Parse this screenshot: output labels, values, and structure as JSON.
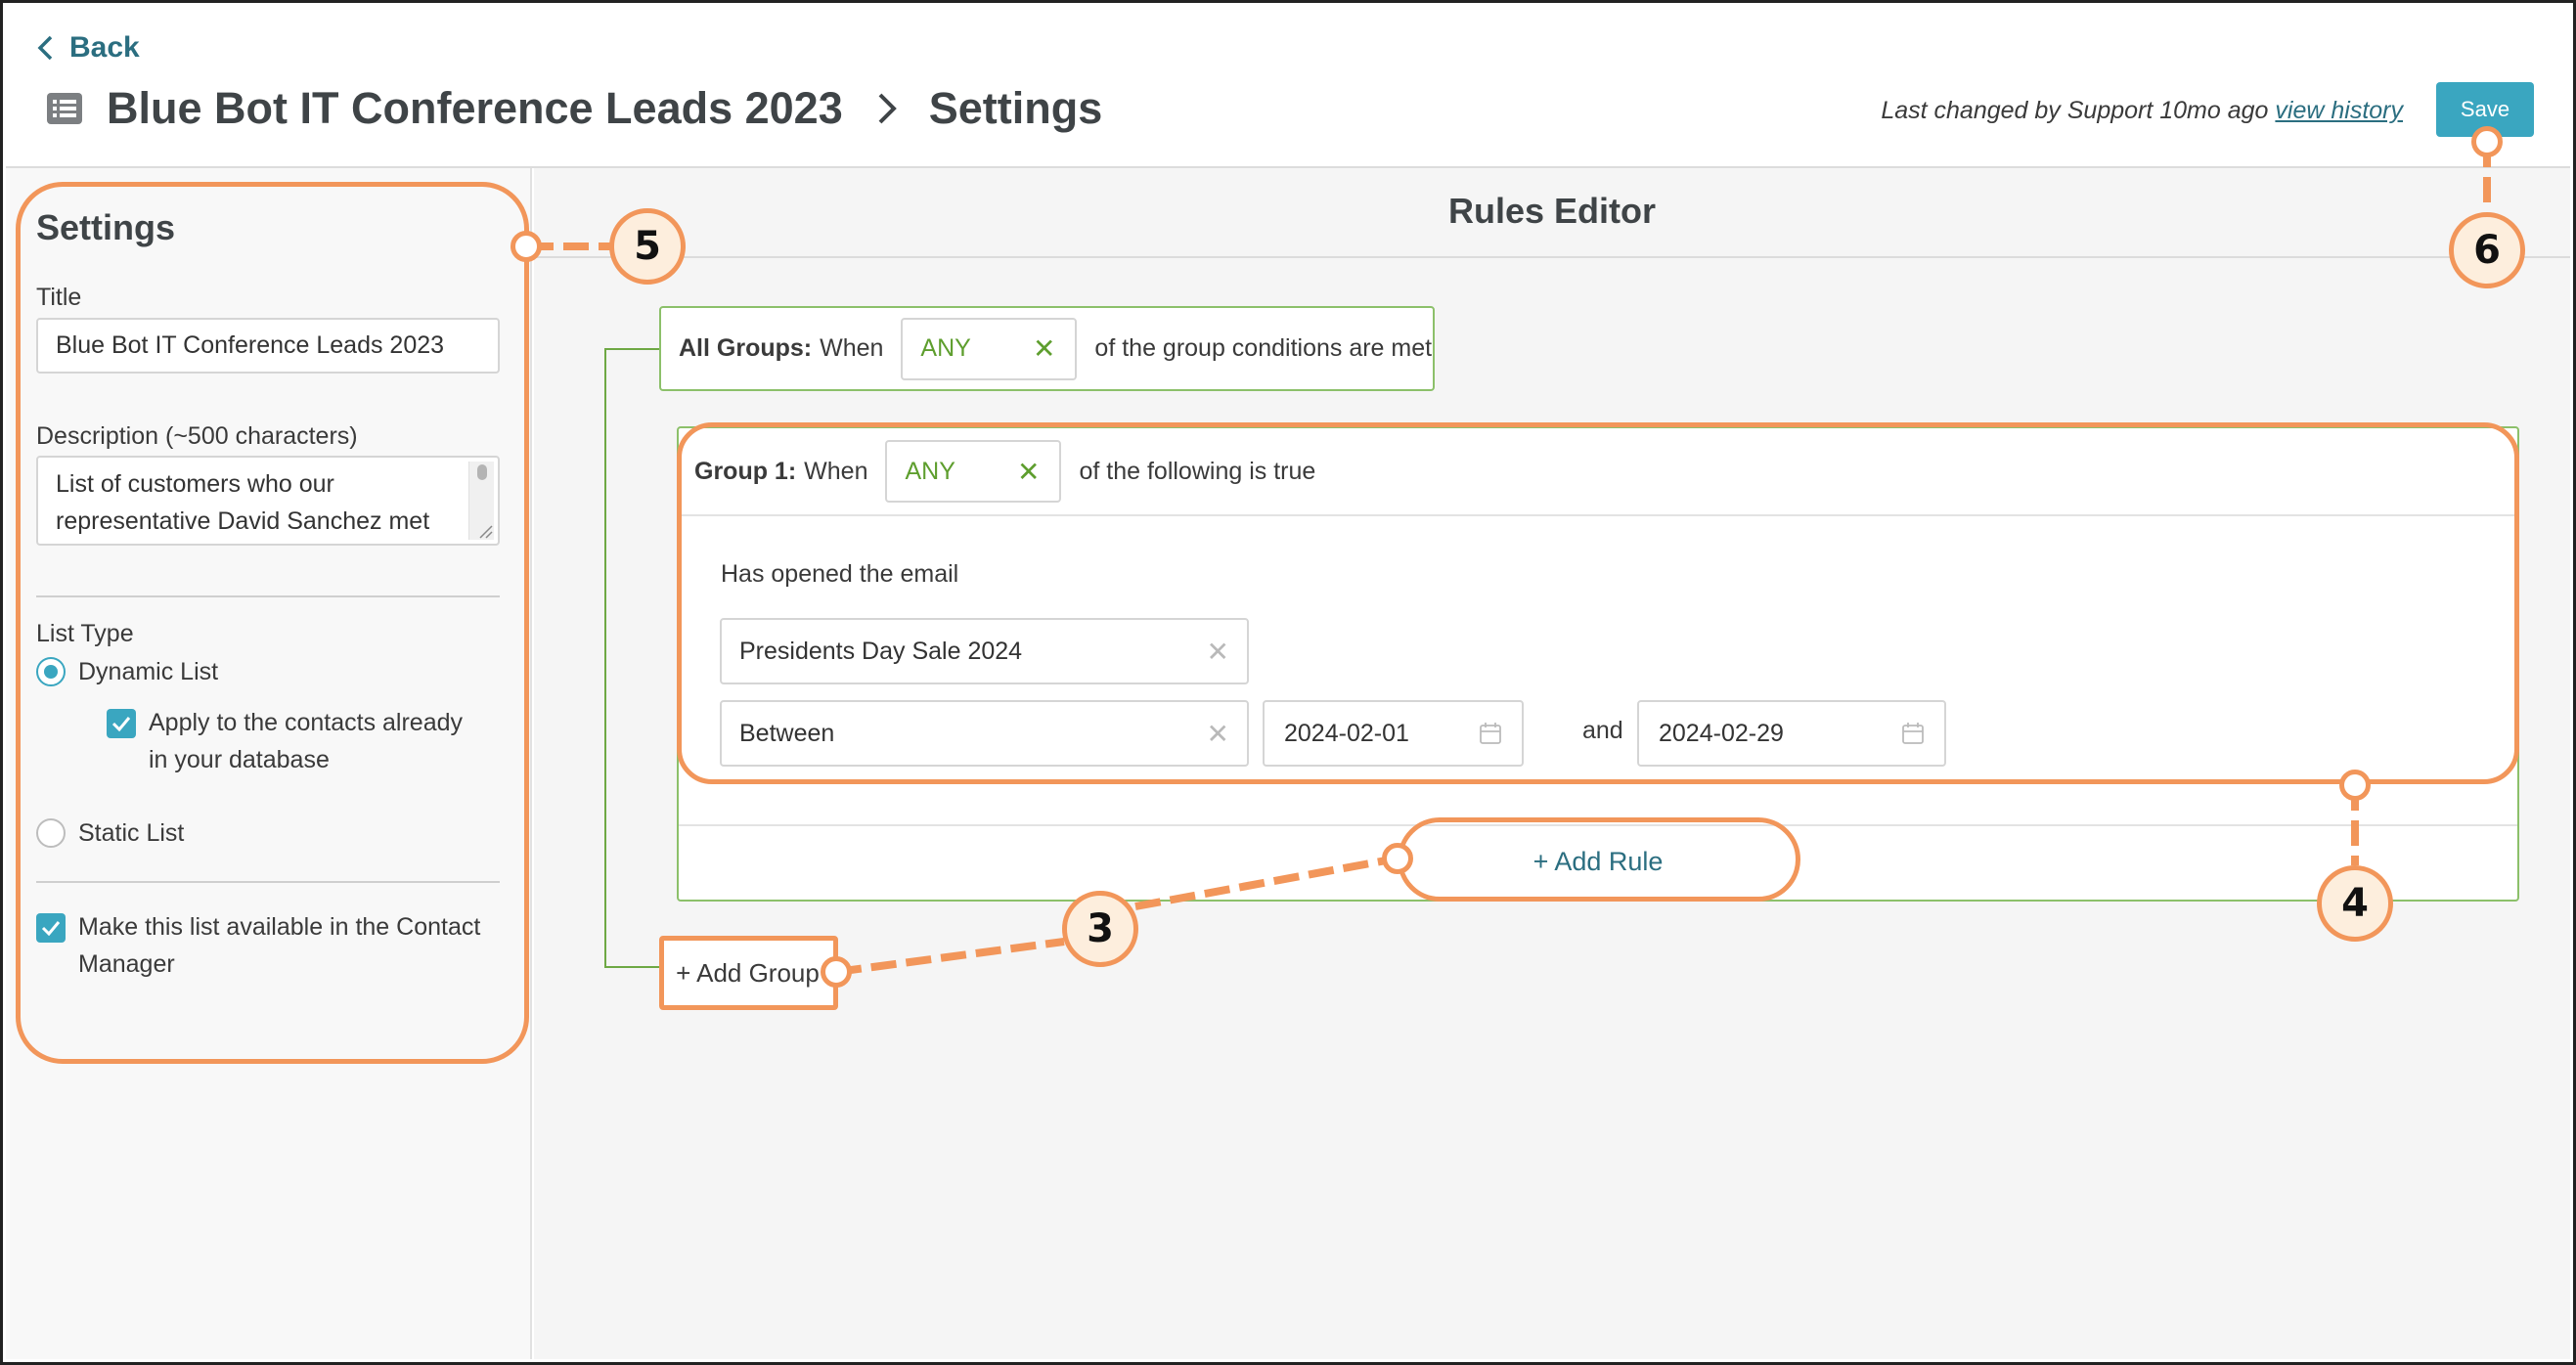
{
  "header": {
    "back_label": "Back",
    "title": "Blue Bot IT Conference Leads 2023",
    "subtitle": "Settings",
    "last_changed_text": "Last changed by Support 10mo ago",
    "view_history_label": "view history",
    "save_label": "Save"
  },
  "sidebar": {
    "heading": "Settings",
    "title_label": "Title",
    "title_value": "Blue Bot IT Conference Leads 2023",
    "description_label": "Description (~500 characters)",
    "description_line1": "List of customers who our",
    "description_line2": "representative David Sanchez met",
    "list_type_label": "List Type",
    "dynamic_label": "Dynamic List",
    "apply_line1": "Apply to the contacts already",
    "apply_line2": "in your database",
    "static_label": "Static List",
    "available_line1": "Make this list available in the Contact",
    "available_line2": "Manager"
  },
  "editor": {
    "heading": "Rules Editor",
    "all_groups_label": "All Groups:",
    "all_groups_when": "When",
    "all_groups_value": "ANY",
    "all_groups_suffix": "of the group conditions are met",
    "group1_label": "Group 1:",
    "group1_when": "When",
    "group1_value": "ANY",
    "group1_suffix": "of the following is true",
    "rule_text": "Has opened the email",
    "email_value": "Presidents Day Sale 2024",
    "operator_value": "Between",
    "date_from": "2024-02-01",
    "and_label": "and",
    "date_to": "2024-02-29",
    "add_rule_label": "+ Add Rule",
    "add_group_label": "+ Add Group"
  },
  "callouts": {
    "c3": "3",
    "c4": "4",
    "c5": "5",
    "c6": "6"
  },
  "colors": {
    "accent": "#3aa6c0",
    "link": "#2b6e80",
    "green": "#5e9e2e",
    "callout": "#f2965a"
  }
}
